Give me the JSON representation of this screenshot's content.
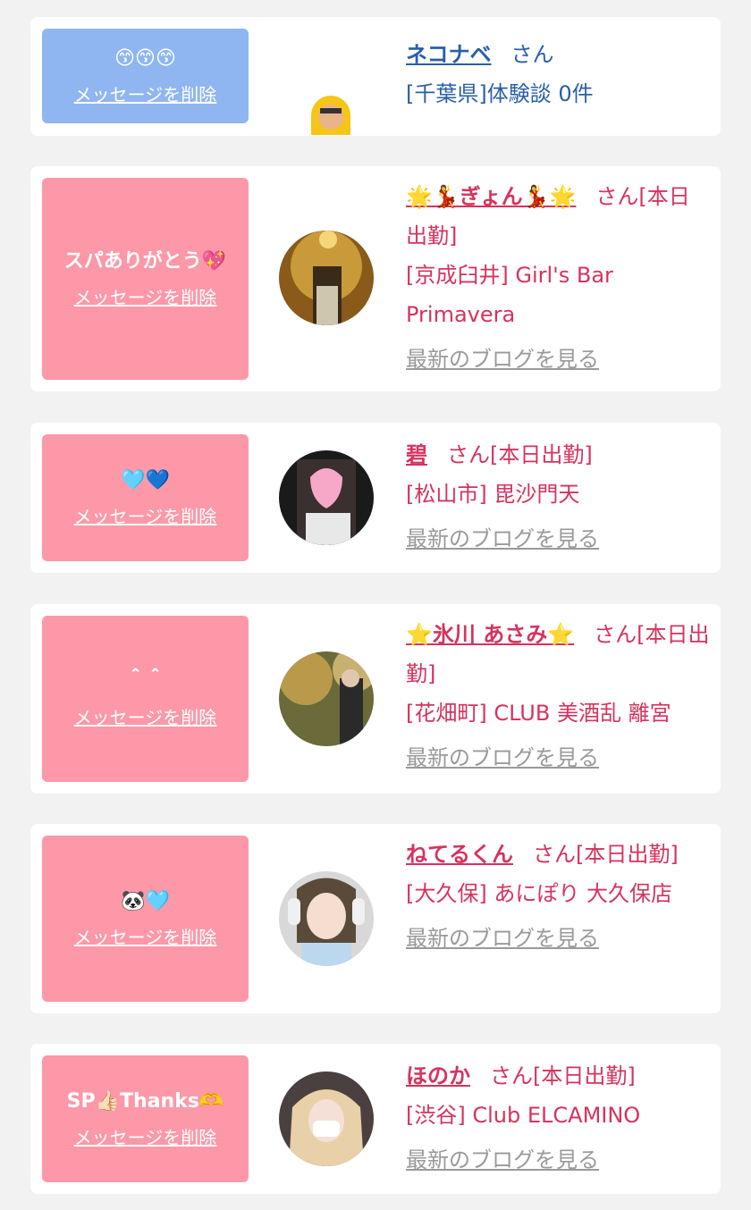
{
  "delete_label": "メッセージを削除",
  "blog_label": "最新のブログを見る",
  "cards": [
    {
      "message": "😙😙😙",
      "name": "ネコナベ",
      "san": "さん",
      "status": "",
      "line2": "[千葉県]体験談 0件"
    },
    {
      "message": "スパありがとう💖",
      "name": "🌟💃ぎょん💃🌟",
      "san": "さん",
      "status": "[本日出勤]",
      "line2": "[京成臼井] Girl's Bar Primavera"
    },
    {
      "message": "🩵💙",
      "name": "碧",
      "san": "さん",
      "status": "[本日出勤]",
      "line2": "[松山市] 毘沙門天"
    },
    {
      "message": "＾＾",
      "name": "⭐氷川 あさみ⭐",
      "san": "さん",
      "status": "[本日出勤]",
      "line2": "[花畑町] CLUB 美酒乱 離宮"
    },
    {
      "message": "🐼🩵",
      "name": "ねてるくん",
      "san": "さん",
      "status": "[本日出勤]",
      "line2": "[大久保] あにぽり 大久保店"
    },
    {
      "message": "SP👍🏻Thanks🫶",
      "name": "ほのか",
      "san": "さん",
      "status": "[本日出勤]",
      "line2": "[渋谷] Club ELCAMINO"
    }
  ]
}
